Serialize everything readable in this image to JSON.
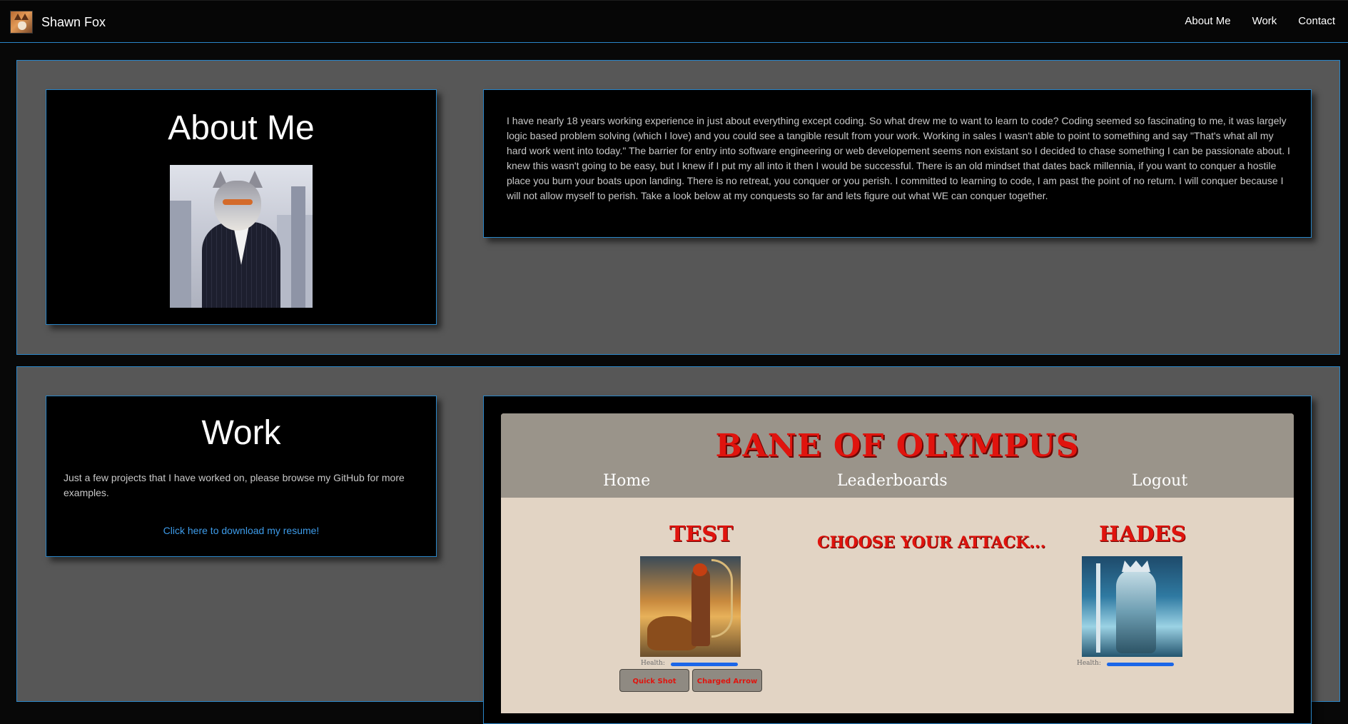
{
  "navbar": {
    "brand_name": "Shawn Fox",
    "links": [
      "About Me",
      "Work",
      "Contact"
    ]
  },
  "about": {
    "title": "About Me",
    "text": "I have nearly 18 years working experience in just about everything except coding. So what drew me to want to learn to code? Coding seemed so fascinating to me, it was largely logic based problem solving (which I love) and you could see a tangible result from your work. Working in sales I wasn't able to point to something and say \"That's what all my hard work went into today.\" The barrier for entry into software engineering or web developement seems non existant so I decided to chase something I can be passionate about. I knew this wasn't going to be easy, but I knew if I put my all into it then I would be successful. There is an old mindset that dates back millennia, if you want to conquer a hostile place you burn your boats upon landing. There is no retreat, you conquer or you perish. I committed to learning to code, I am past the point of no return. I will conquer because I will not allow myself to perish. Take a look below at my conquests so far and lets figure out what WE can conquer together."
  },
  "work": {
    "title": "Work",
    "description": "Just a few projects that I have worked on, please browse my GitHub for more examples.",
    "resume_link": "Click here to download my resume!"
  },
  "game": {
    "title": "BANE OF OLYMPUS",
    "nav": [
      "Home",
      "Leaderboards",
      "Logout"
    ],
    "player_name": "TEST",
    "enemy_name": "HADES",
    "prompt": "CHOOSE YOUR ATTACK...",
    "health_label": "Health:",
    "player_health": 1.0,
    "enemy_health": 1.0,
    "attacks": [
      "Quick Shot",
      "Charged Arrow"
    ]
  },
  "colors": {
    "accent": "#2a86c8",
    "link": "#3d9be9",
    "game_red": "#e0140e",
    "health_blue": "#1b66e8"
  }
}
